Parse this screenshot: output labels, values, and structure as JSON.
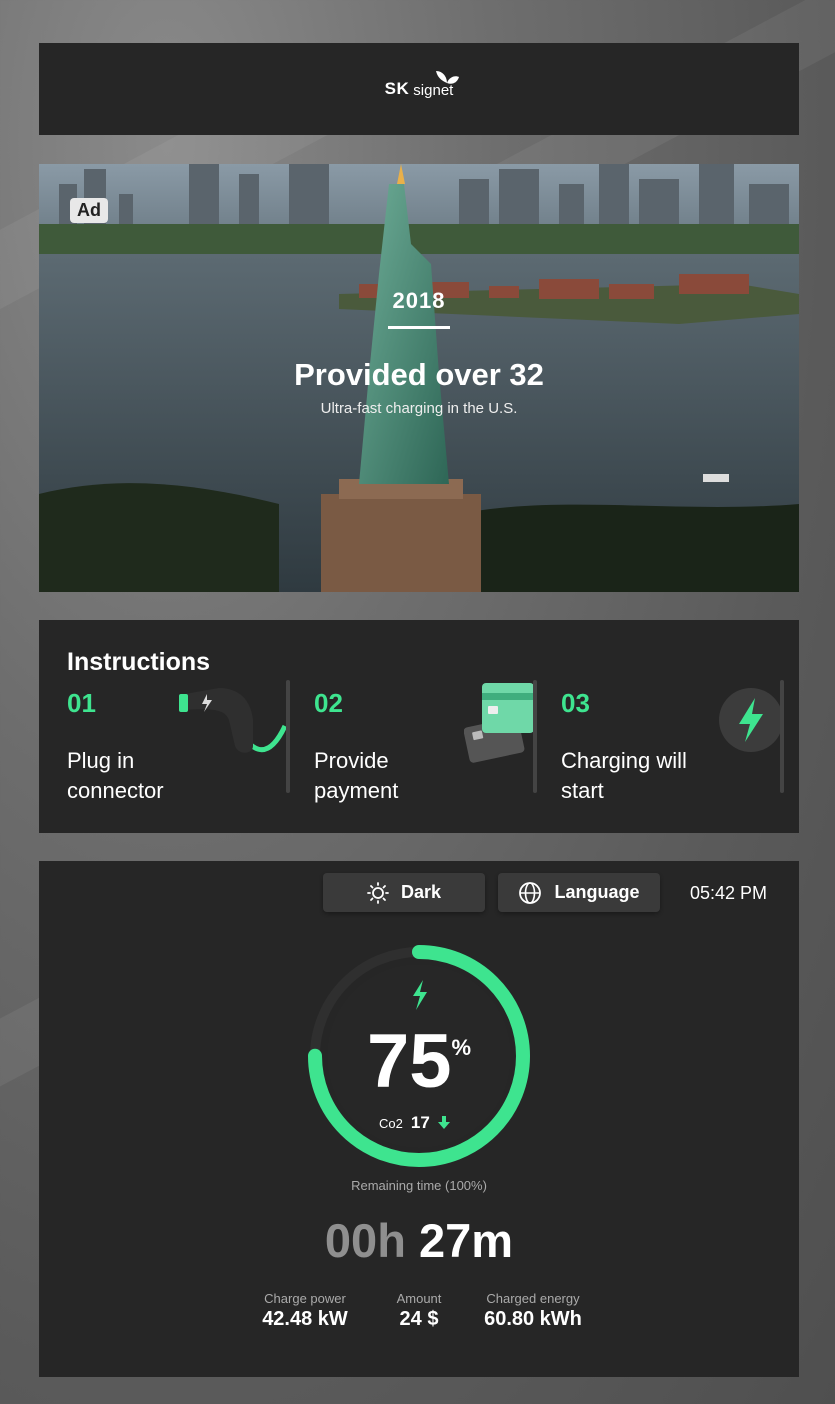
{
  "brand": {
    "sk": "SK",
    "signet": "signet"
  },
  "ad": {
    "badge": "Ad",
    "year": "2018",
    "headline": "Provided over 32",
    "subtitle": "Ultra-fast charging in the U.S."
  },
  "instructions": {
    "title": "Instructions",
    "steps": [
      {
        "num": "01",
        "text": "Plug in connector",
        "icon": "charging-connector-icon"
      },
      {
        "num": "02",
        "text": "Provide payment",
        "icon": "credit-cards-icon"
      },
      {
        "num": "03",
        "text": "Charging will start",
        "icon": "lightning-icon"
      }
    ]
  },
  "controls": {
    "theme_label": "Dark",
    "language_label": "Language",
    "clock": "05:42 PM"
  },
  "status": {
    "percent": "75",
    "percent_sign": "%",
    "progress_fraction": 0.75,
    "co2_label": "Co2",
    "co2_value": "17",
    "remaining_label": "Remaining time (100%)",
    "time_hours": "00h",
    "time_minutes": "27m"
  },
  "stats": [
    {
      "label": "Charge power",
      "value": "42.48 kW"
    },
    {
      "label": "Amount",
      "value": "24 $"
    },
    {
      "label": "Charged energy",
      "value": "60.80 kWh"
    }
  ],
  "colors": {
    "accent": "#3ee48f",
    "panel": "#262626",
    "pill": "#3a3a3a"
  }
}
